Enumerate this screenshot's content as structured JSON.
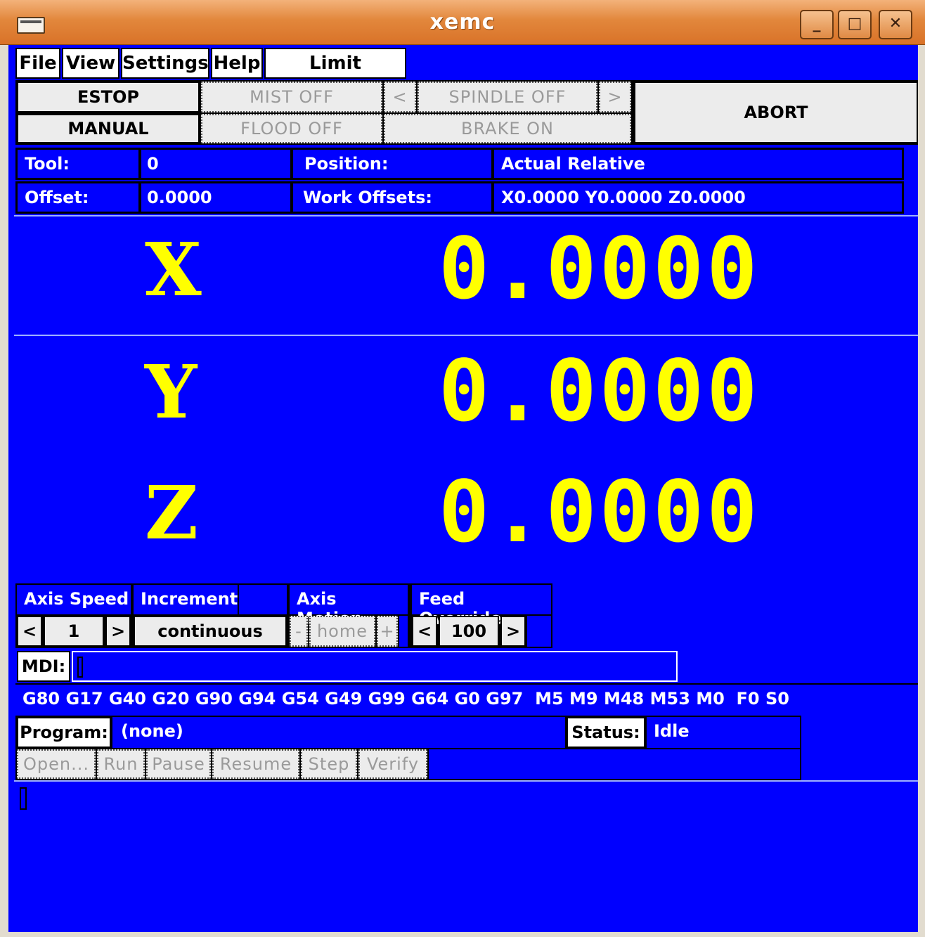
{
  "window": {
    "title": "xemc",
    "minimize": "_",
    "maximize": "□",
    "close": "✕"
  },
  "menu": {
    "file": "File",
    "view": "View",
    "settings": "Settings",
    "help": "Help",
    "limit_override": "Limit Override"
  },
  "controls": {
    "estop": "ESTOP",
    "manual": "MANUAL",
    "mist": "MIST OFF",
    "flood": "FLOOD OFF",
    "spindle_dec": "<",
    "spindle": "SPINDLE OFF",
    "spindle_inc": ">",
    "brake": "BRAKE ON",
    "abort": "ABORT"
  },
  "info": {
    "tool_label": "Tool:",
    "tool_value": "0",
    "position_label": "Position:",
    "position_value": "Actual Relative",
    "offset_label": "Offset:",
    "offset_value": "0.0000",
    "work_offsets_label": "Work Offsets:",
    "work_offsets_value": "X0.0000  Y0.0000  Z0.0000"
  },
  "axes": [
    {
      "letter": "X",
      "value": "0.0000"
    },
    {
      "letter": "Y",
      "value": "0.0000"
    },
    {
      "letter": "Z",
      "value": "0.0000"
    }
  ],
  "jog": {
    "axis_speed_label": "Axis Speed",
    "axis_speed_dec": "<",
    "axis_speed_value": "1",
    "axis_speed_inc": ">",
    "increment_label": "Increment",
    "increment_value": "continuous",
    "axis_motion_label": "Axis Motion",
    "axis_motion_minus": "-",
    "axis_motion_home": "home",
    "axis_motion_plus": "+",
    "feed_override_label": "Feed Override",
    "feed_dec": "<",
    "feed_value": "100",
    "feed_inc": ">"
  },
  "mdi": {
    "label": "MDI:",
    "value": ""
  },
  "modes": "G80 G17 G40 G20 G90 G94 G54 G49 G99 G64 G0 G97  M5 M9 M48 M53 M0  F0 S0",
  "program": {
    "label": "Program:",
    "value": "(none)",
    "status_label": "Status:",
    "status_value": "Idle",
    "buttons": {
      "open": "Open...",
      "run": "Run",
      "pause": "Pause",
      "resume": "Resume",
      "step": "Step",
      "verify": "Verify"
    }
  },
  "colors": {
    "background": "#0000ff",
    "axis_text": "#ffff00",
    "title_bar": "#e2873c"
  }
}
